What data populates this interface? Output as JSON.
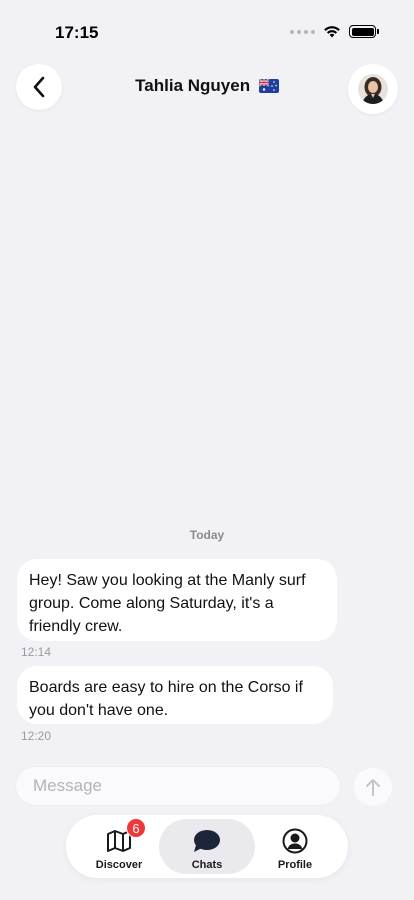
{
  "status_bar": {
    "time": "17:15"
  },
  "header": {
    "title": "Tahlia Nguyen",
    "flag_emoji": "🇦🇺"
  },
  "conversation": {
    "date_separator": "Today",
    "messages": [
      {
        "text": "Hey! Saw you looking at the Manly surf group. Come along Saturday, it's a friendly crew.",
        "time": "12:14"
      },
      {
        "text": "Boards are easy to hire on the Corso if you don't have one.",
        "time": "12:20"
      }
    ]
  },
  "composer": {
    "placeholder": "Message",
    "value": ""
  },
  "tabs": [
    {
      "label": "Discover",
      "icon": "map-icon",
      "active": false
    },
    {
      "label": "Chats",
      "icon": "chat-bubble-icon",
      "active": true,
      "badge": "6"
    },
    {
      "label": "Profile",
      "icon": "person-circle-icon",
      "active": false
    }
  ],
  "colors": {
    "background": "#f2f2f6",
    "badge": "#f0383b",
    "chats_icon": "#1c2638"
  }
}
